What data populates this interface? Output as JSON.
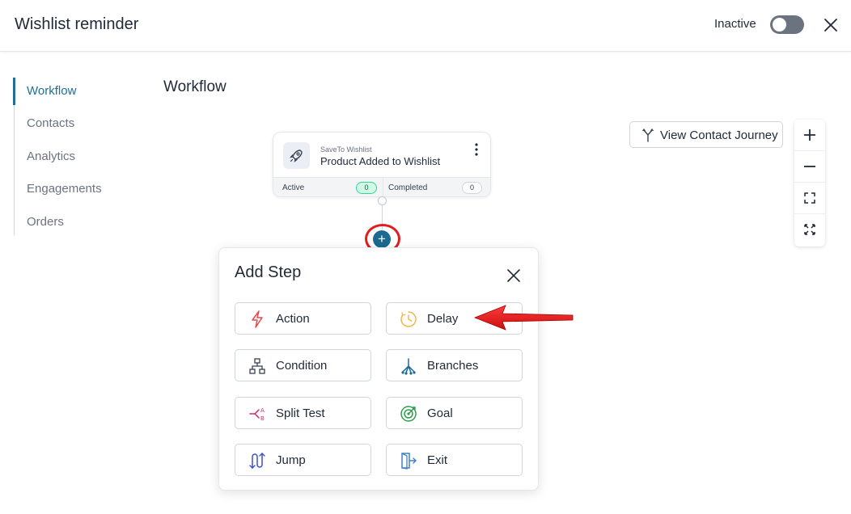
{
  "header": {
    "title": "Wishlist reminder",
    "status_label": "Inactive"
  },
  "sidebar": {
    "items": [
      {
        "label": "Workflow",
        "active": true
      },
      {
        "label": "Contacts",
        "active": false
      },
      {
        "label": "Analytics",
        "active": false
      },
      {
        "label": "Engagements",
        "active": false
      },
      {
        "label": "Orders",
        "active": false
      }
    ]
  },
  "main": {
    "title": "Workflow",
    "trigger": {
      "subtitle": "SaveTo Wishlist",
      "title": "Product Added to Wishlist",
      "active_label": "Active",
      "active_count": "0",
      "completed_label": "Completed",
      "completed_count": "0"
    },
    "journey_button": "View Contact Journey",
    "add_node_symbol": "+"
  },
  "zoom_controls": [
    "zoom-in-icon",
    "zoom-out-icon",
    "fit-view-icon",
    "fullscreen-icon"
  ],
  "add_step": {
    "title": "Add Step",
    "steps": [
      {
        "label": "Action",
        "icon": "lightning-icon",
        "color": "#e5484d"
      },
      {
        "label": "Delay",
        "icon": "clock-icon",
        "color": "#f5b544"
      },
      {
        "label": "Condition",
        "icon": "hierarchy-icon",
        "color": "#374151"
      },
      {
        "label": "Branches",
        "icon": "branches-icon",
        "color": "#1b6a8f"
      },
      {
        "label": "Split Test",
        "icon": "split-test-icon",
        "color": "#e0245e"
      },
      {
        "label": "Goal",
        "icon": "target-icon",
        "color": "#2e9e4f"
      },
      {
        "label": "Jump",
        "icon": "jump-icon",
        "color": "#3b4fd1"
      },
      {
        "label": "Exit",
        "icon": "exit-icon",
        "color": "#3b82c4"
      }
    ]
  },
  "colors": {
    "accent": "#1f6f96",
    "highlight": "#e11d1d",
    "active_badge": "#34d399"
  }
}
